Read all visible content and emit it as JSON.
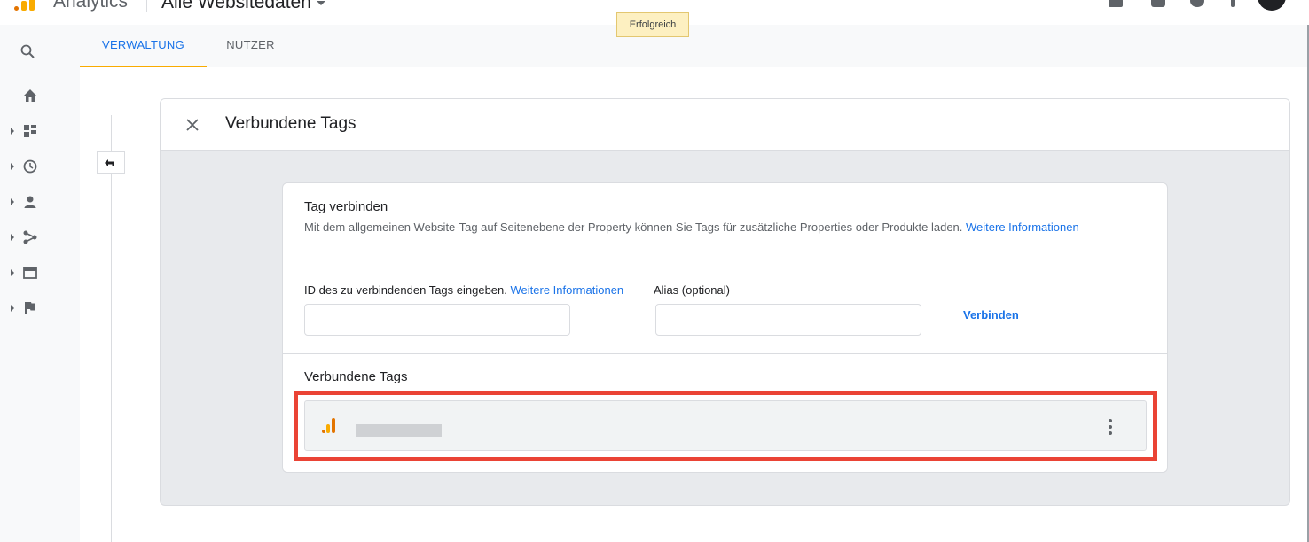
{
  "header": {
    "product": "Analytics",
    "account": "Alle Websitedaten"
  },
  "toast": "Erfolgreich",
  "tabs": [
    {
      "label": "VERWALTUNG",
      "active": true
    },
    {
      "label": "NUTZER",
      "active": false
    }
  ],
  "leftnav": {
    "items": [
      "search-icon",
      "home-icon",
      "dashboard-icon",
      "clock-icon",
      "person-icon",
      "share-icon",
      "browser-icon",
      "flag-icon"
    ]
  },
  "panel": {
    "title": "Verbundene Tags",
    "connect_section": {
      "title": "Tag verbinden",
      "description": "Mit dem allgemeinen Website-Tag auf Seitenebene der Property können Sie Tags für zusätzliche Properties oder Produkte laden.",
      "description_link": "Weitere Informationen",
      "id_label": "ID des zu verbindenden Tags eingeben.",
      "id_link": "Weitere Informationen",
      "id_value": "",
      "alias_label": "Alias (optional)",
      "alias_value": "",
      "connect_button": "Verbinden"
    },
    "list_section": {
      "title": "Verbundene Tags"
    }
  },
  "colors": {
    "accent": "#1a73e8",
    "highlight": "#ea4335",
    "brand": "#f9ab00",
    "toast_bg": "#fdf0c1"
  }
}
